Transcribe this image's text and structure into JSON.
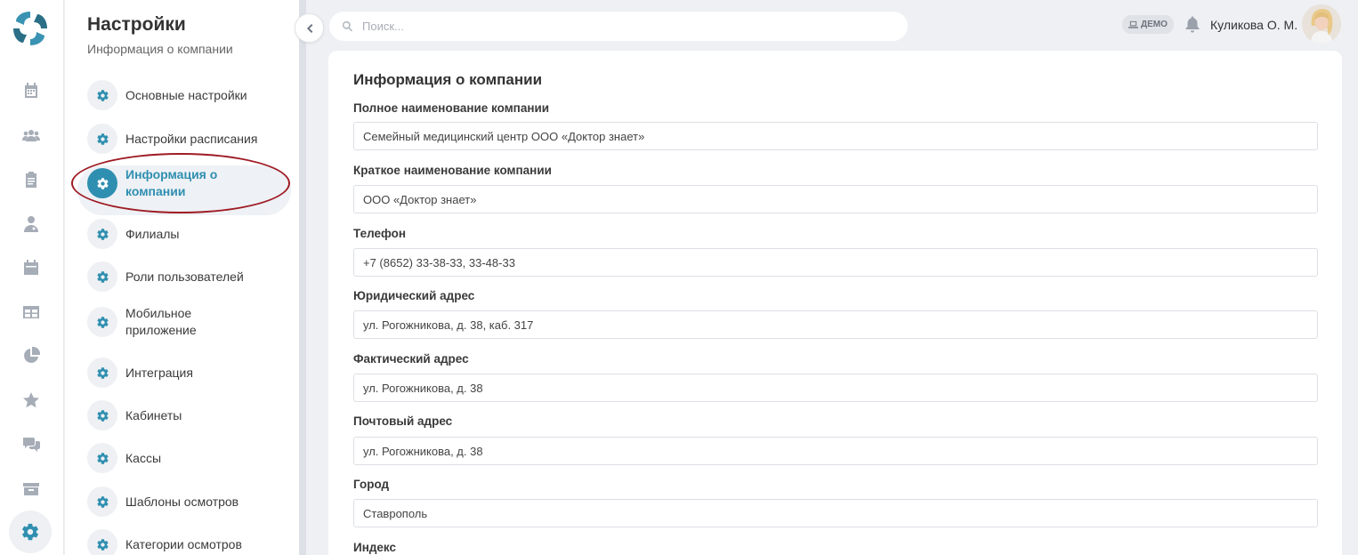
{
  "rail": {
    "icons": [
      "logo-icon",
      "calendar-icon",
      "users-icon",
      "clipboard-icon",
      "doctor-icon",
      "schedule-icon",
      "table-icon",
      "pie-chart-icon",
      "star-icon",
      "chat-icon",
      "box-icon",
      "gear-icon"
    ]
  },
  "panel": {
    "title": "Настройки",
    "subtitle": "Информация о компании",
    "items": [
      {
        "label": "Основные настройки"
      },
      {
        "label": "Настройки расписания"
      },
      {
        "label": "Информация о компании",
        "active": true
      },
      {
        "label": "Филиалы"
      },
      {
        "label": "Роли пользователей"
      },
      {
        "label": "Мобильное приложение"
      },
      {
        "label": "Интеграция"
      },
      {
        "label": "Кабинеты"
      },
      {
        "label": "Кассы"
      },
      {
        "label": "Шаблоны осмотров"
      },
      {
        "label": "Категории осмотров"
      }
    ]
  },
  "header": {
    "search_placeholder": "Поиск...",
    "demo_badge": "ДЕМО",
    "user_name": "Куликова О. М."
  },
  "content": {
    "title": "Информация о компании",
    "fields": [
      {
        "label": "Полное наименование компании",
        "value": "Семейный медицинский центр ООО «Доктор знает»"
      },
      {
        "label": "Краткое наименование компании",
        "value": "ООО «Доктор знает»"
      },
      {
        "label": "Телефон",
        "value": "+7 (8652) 33-38-33, 33-48-33"
      },
      {
        "label": "Юридический адрес",
        "value": "ул. Рогожникова, д. 38, каб. 317"
      },
      {
        "label": "Фактический адрес",
        "value": "ул. Рогожникова, д. 38"
      },
      {
        "label": "Почтовый адрес",
        "value": "ул. Рогожникова, д. 38"
      },
      {
        "label": "Город",
        "value": "Ставрополь"
      },
      {
        "label": "Индекс",
        "value": ""
      }
    ]
  },
  "colors": {
    "accent": "#2f8fb0",
    "highlight_ring": "#9e1b24",
    "background": "#eef0f4"
  }
}
